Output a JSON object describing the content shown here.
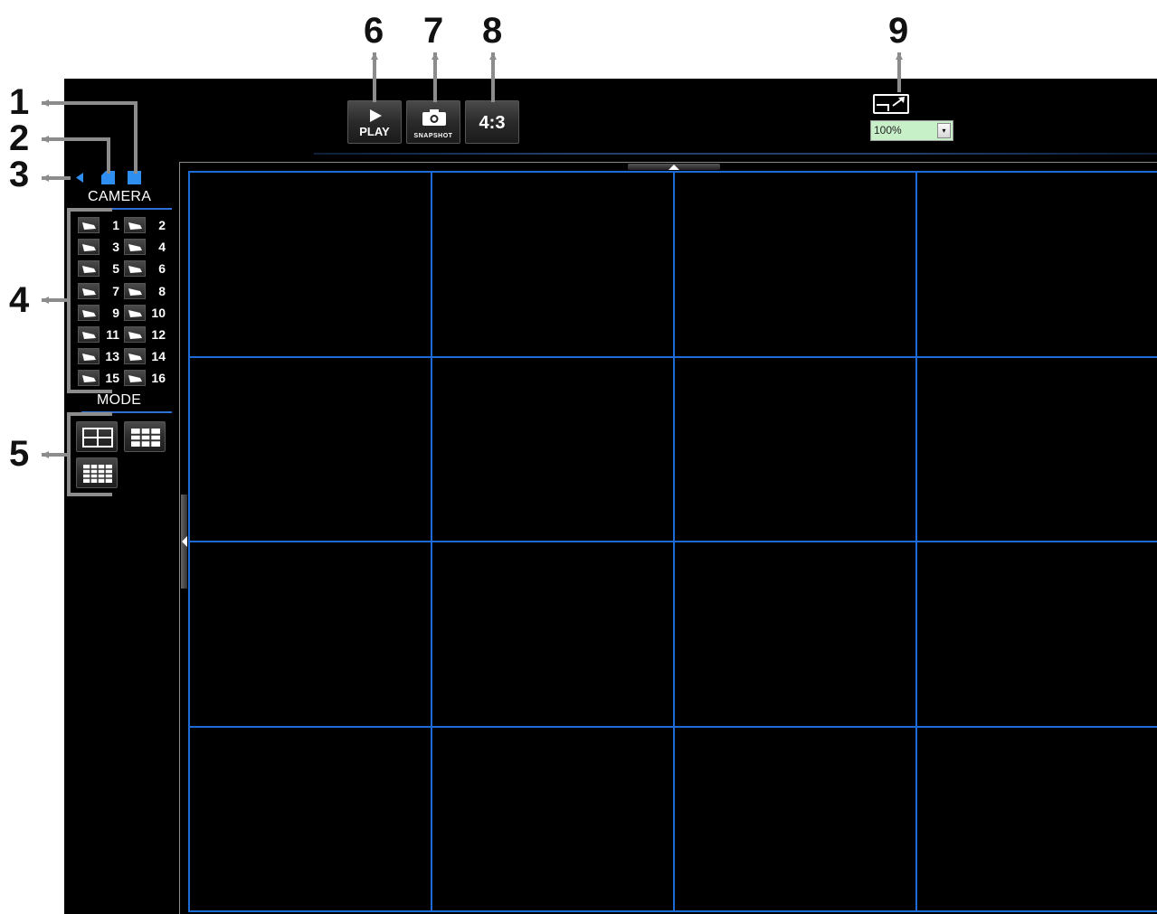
{
  "callouts": [
    "1",
    "2",
    "3",
    "4",
    "5",
    "6",
    "7",
    "8",
    "9"
  ],
  "toolbar": {
    "play_label": "PLAY",
    "snapshot_label": "SNAPSHOT",
    "aspect_label": "4:3"
  },
  "zoom": {
    "value": "100%",
    "dropdown_glyph": "▾",
    "icon": "fit-window-icon"
  },
  "sidebar": {
    "view_buttons": [
      {
        "name": "collapse-button",
        "icon": "triangle-left-icon",
        "color": "#2f8ff0"
      },
      {
        "name": "half-view-button",
        "icon": "corner-square-icon",
        "color": "#2f8ff0"
      },
      {
        "name": "full-view-button",
        "icon": "square-icon",
        "color": "#2f8ff0"
      }
    ],
    "camera_title": "CAMERA",
    "cameras": [
      "1",
      "2",
      "3",
      "4",
      "5",
      "6",
      "7",
      "8",
      "9",
      "10",
      "11",
      "12",
      "13",
      "14",
      "15",
      "16"
    ],
    "mode_title": "MODE",
    "modes": [
      {
        "name": "mode-2x2-button",
        "grid": "2x2",
        "icon": "grid-2x2-icon"
      },
      {
        "name": "mode-3x3-button",
        "grid": "3x3",
        "icon": "grid-3x3-icon"
      },
      {
        "name": "mode-4x4-button",
        "grid": "4x4",
        "icon": "grid-4x4-icon"
      }
    ]
  },
  "video_grid": {
    "rows": 4,
    "cols": 4,
    "border_color": "#1f6bd6"
  },
  "colors": {
    "app_background": "#000000",
    "accent_blue": "#2f8ff0",
    "zoom_field": "#c8f0c8",
    "callout": "#8c8c8c"
  }
}
